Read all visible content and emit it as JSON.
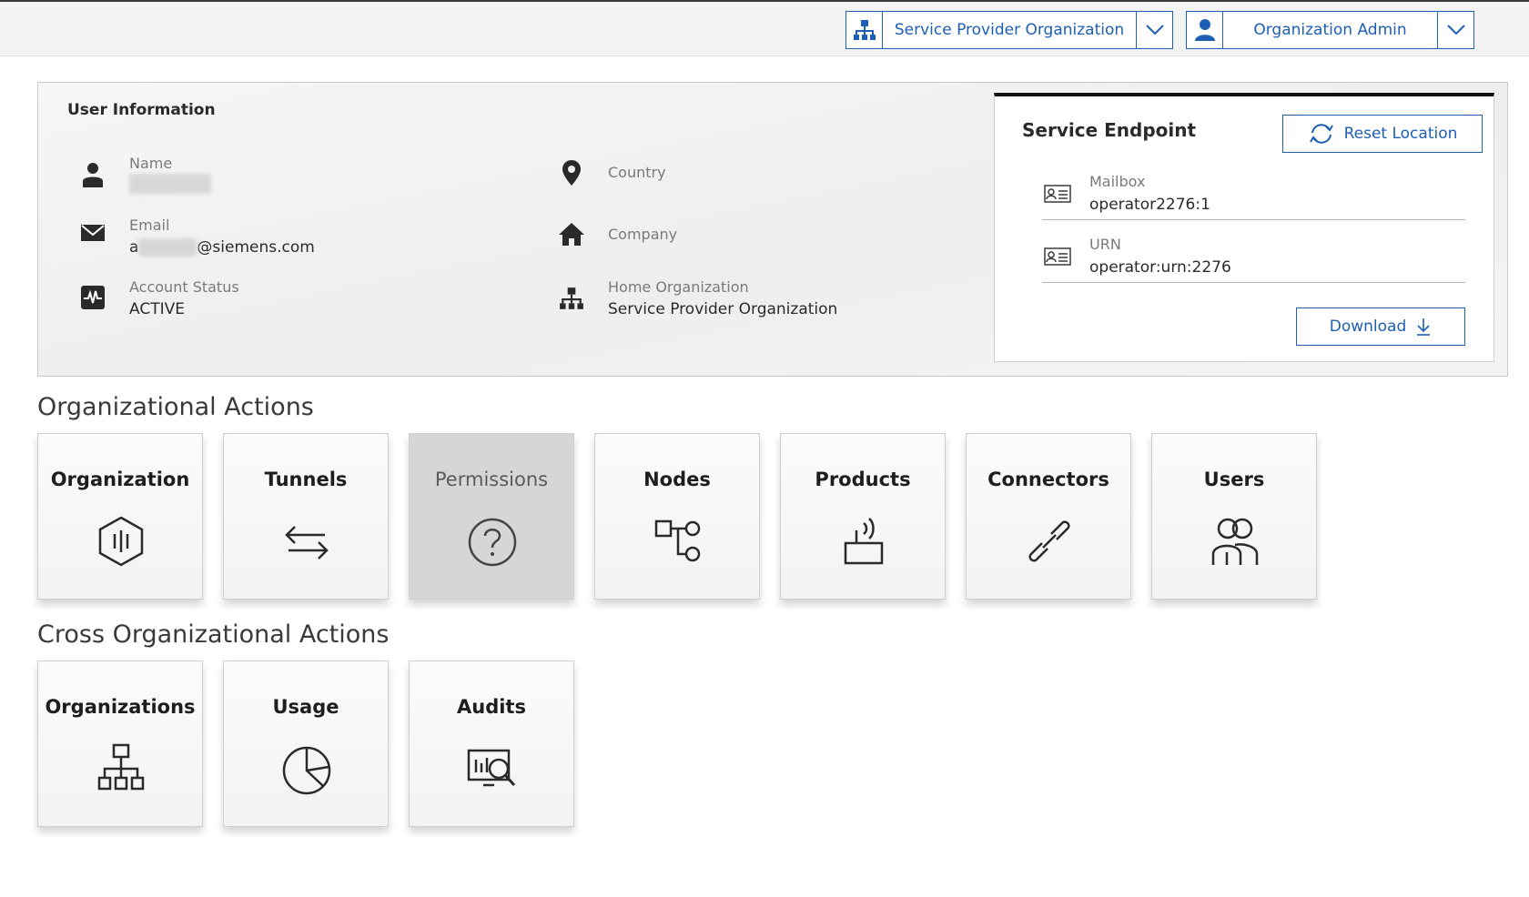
{
  "header": {
    "org_selector": {
      "label": "Service Provider Organization",
      "icon": "org-hierarchy-icon"
    },
    "role_selector": {
      "label": "Organization Admin",
      "icon": "user-icon"
    }
  },
  "user_info": {
    "title": "User Information",
    "name": {
      "label": "Name",
      "value": ""
    },
    "email": {
      "label": "Email",
      "prefix": "a",
      "suffix": "@siemens.com"
    },
    "account_status": {
      "label": "Account Status",
      "value": "ACTIVE"
    },
    "country": {
      "label": "Country",
      "value": ""
    },
    "company": {
      "label": "Company",
      "value": ""
    },
    "home_org": {
      "label": "Home Organization",
      "value": "Service Provider Organization"
    }
  },
  "service_endpoint": {
    "title": "Service Endpoint",
    "reset_label": "Reset Location",
    "mailbox": {
      "label": "Mailbox",
      "value": "operator2276:1"
    },
    "urn": {
      "label": "URN",
      "value": "operator:urn:2276"
    },
    "download_label": "Download"
  },
  "org_actions": {
    "title": "Organizational Actions",
    "tiles": [
      {
        "label": "Organization",
        "icon": "hexagon-icon"
      },
      {
        "label": "Tunnels",
        "icon": "arrows-exchange-icon"
      },
      {
        "label": "Permissions",
        "icon": "question-icon",
        "disabled": true
      },
      {
        "label": "Nodes",
        "icon": "nodes-icon"
      },
      {
        "label": "Products",
        "icon": "device-antenna-icon"
      },
      {
        "label": "Connectors",
        "icon": "link-icon"
      },
      {
        "label": "Users",
        "icon": "users-icon"
      }
    ]
  },
  "cross_actions": {
    "title": "Cross Organizational Actions",
    "tiles": [
      {
        "label": "Organizations",
        "icon": "org-hierarchy-icon"
      },
      {
        "label": "Usage",
        "icon": "pie-chart-icon"
      },
      {
        "label": "Audits",
        "icon": "audit-monitor-icon"
      }
    ]
  },
  "colors": {
    "accent": "#1e5fb4",
    "panel_bg": "#f0f0f0",
    "disabled_tile": "#d6d6d6"
  }
}
